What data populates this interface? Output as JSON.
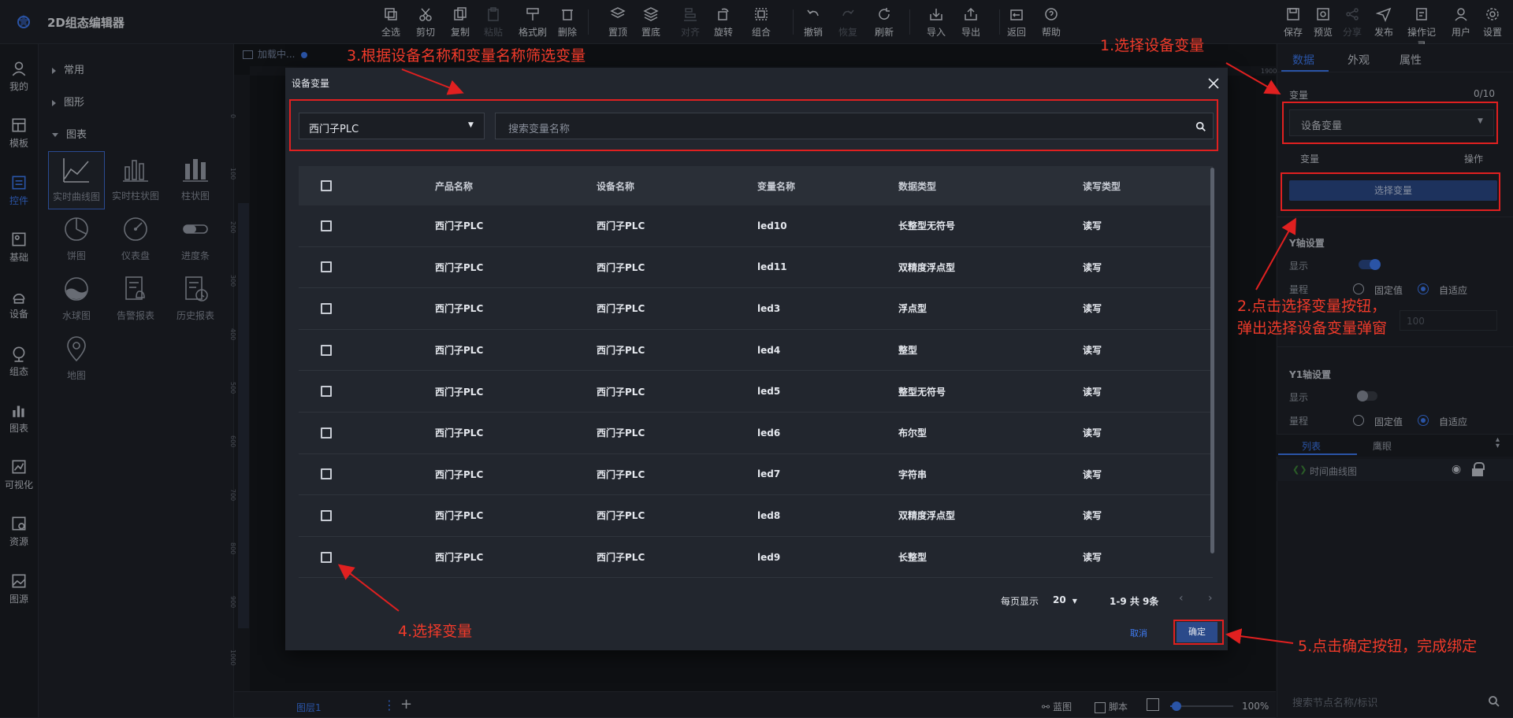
{
  "app": {
    "title": "2D组态编辑器"
  },
  "toolbar": {
    "items": [
      {
        "label": "全选",
        "icon": "select-all-icon",
        "disabled": false
      },
      {
        "label": "剪切",
        "icon": "cut-icon",
        "disabled": false
      },
      {
        "label": "复制",
        "icon": "copy-icon",
        "disabled": false
      },
      {
        "label": "粘贴",
        "icon": "paste-icon",
        "disabled": true
      },
      {
        "label": "格式刷",
        "icon": "format-brush-icon",
        "disabled": false
      },
      {
        "label": "删除",
        "icon": "delete-icon",
        "disabled": false
      },
      {
        "label": "置顶",
        "icon": "bring-to-front-icon",
        "disabled": false
      },
      {
        "label": "置底",
        "icon": "send-to-back-icon",
        "disabled": false
      },
      {
        "label": "对齐",
        "icon": "align-icon",
        "disabled": true
      },
      {
        "label": "旋转",
        "icon": "rotate-icon",
        "disabled": false
      },
      {
        "label": "组合",
        "icon": "group-icon",
        "disabled": false
      },
      {
        "label": "撤销",
        "icon": "undo-icon",
        "disabled": false
      },
      {
        "label": "恢复",
        "icon": "redo-icon",
        "disabled": true
      },
      {
        "label": "刷新",
        "icon": "refresh-icon",
        "disabled": false
      },
      {
        "label": "导入",
        "icon": "import-icon",
        "disabled": false
      },
      {
        "label": "导出",
        "icon": "export-icon",
        "disabled": false
      },
      {
        "label": "返回",
        "icon": "back-icon",
        "disabled": false
      },
      {
        "label": "帮助",
        "icon": "help-icon",
        "disabled": false
      }
    ],
    "right_items": [
      {
        "label": "保存",
        "icon": "save-icon",
        "disabled": false
      },
      {
        "label": "预览",
        "icon": "preview-icon",
        "disabled": false
      },
      {
        "label": "分享",
        "icon": "share-icon",
        "disabled": true
      },
      {
        "label": "发布",
        "icon": "publish-icon",
        "disabled": false
      },
      {
        "label": "操作记录",
        "icon": "history-icon",
        "disabled": false
      },
      {
        "label": "用户",
        "icon": "user-icon",
        "disabled": false
      },
      {
        "label": "设置",
        "icon": "settings-icon",
        "disabled": false
      }
    ]
  },
  "left_nav": {
    "items": [
      {
        "label": "我的",
        "icon": "user-icon",
        "active": false
      },
      {
        "label": "模板",
        "icon": "template-icon",
        "active": false
      },
      {
        "label": "控件",
        "icon": "widget-icon",
        "active": true
      },
      {
        "label": "基础",
        "icon": "basic-icon",
        "active": false
      },
      {
        "label": "设备",
        "icon": "device-icon",
        "active": false
      },
      {
        "label": "组态",
        "icon": "scada-icon",
        "active": false
      },
      {
        "label": "图表",
        "icon": "chart-icon",
        "active": false
      },
      {
        "label": "可视化",
        "icon": "visual-icon",
        "active": false
      },
      {
        "label": "资源",
        "icon": "resource-icon",
        "active": false
      },
      {
        "label": "图源",
        "icon": "image-source-icon",
        "active": false
      }
    ]
  },
  "component_panel": {
    "groups": [
      "常用",
      "图形",
      "图表"
    ],
    "components": [
      {
        "label": "实时曲线图",
        "icon": "line-chart-icon",
        "selected": true
      },
      {
        "label": "实时柱状图",
        "icon": "realtime-bar-chart-icon",
        "selected": false
      },
      {
        "label": "柱状图",
        "icon": "bar-chart-icon",
        "selected": false
      },
      {
        "label": "饼图",
        "icon": "pie-chart-icon",
        "selected": false
      },
      {
        "label": "仪表盘",
        "icon": "gauge-icon",
        "selected": false
      },
      {
        "label": "进度条",
        "icon": "progress-icon",
        "selected": false
      },
      {
        "label": "水球图",
        "icon": "liquid-fill-icon",
        "selected": false
      },
      {
        "label": "告警报表",
        "icon": "alarm-report-icon",
        "selected": false
      },
      {
        "label": "历史报表",
        "icon": "history-report-icon",
        "selected": false
      },
      {
        "label": "地图",
        "icon": "map-icon",
        "selected": false
      }
    ]
  },
  "canvas": {
    "tab_label": "加载中...",
    "ruler_top_end": "1900",
    "ruler_left": [
      "0",
      "100",
      "200",
      "300",
      "400",
      "500",
      "600",
      "700",
      "800",
      "900",
      "1000"
    ]
  },
  "bottom_bar": {
    "layer_label": "图层1",
    "blueprint_label": "蓝图",
    "script_label": "脚本",
    "zoom": "100%",
    "zoom_fraction": 0.1
  },
  "right_panel": {
    "tabs": [
      "数据",
      "外观",
      "属性"
    ],
    "active_tab": 0,
    "variable_label": "变量",
    "variable_count": "0/10",
    "variable_type_value": "设备变量",
    "col_variable": "变量",
    "col_action": "操作",
    "select_variable_button": "选择变量",
    "y_axis": {
      "title": "Y轴设置",
      "show_label": "显示",
      "range_label": "量程",
      "fixed_label": "固定值",
      "auto_label": "自适应",
      "max_placeholder": "100",
      "show_on": true
    },
    "y1_axis": {
      "title": "Y1轴设置",
      "show_label": "显示",
      "range_label": "量程",
      "fixed_label": "固定值",
      "auto_label": "自适应",
      "show_on": false
    },
    "list_tabs": [
      "列表",
      "鹰眼"
    ],
    "tree_node": "时间曲线图",
    "search_placeholder": "搜索节点名称/标识"
  },
  "modal": {
    "title": "设备变量",
    "device_select": "西门子PLC",
    "search_placeholder": "搜索变量名称",
    "columns": [
      "产品名称",
      "设备名称",
      "变量名称",
      "数据类型",
      "读写类型"
    ],
    "rows": [
      [
        "西门子PLC",
        "西门子PLC",
        "led10",
        "长整型无符号",
        "读写"
      ],
      [
        "西门子PLC",
        "西门子PLC",
        "led11",
        "双精度浮点型",
        "读写"
      ],
      [
        "西门子PLC",
        "西门子PLC",
        "led3",
        "浮点型",
        "读写"
      ],
      [
        "西门子PLC",
        "西门子PLC",
        "led4",
        "整型",
        "读写"
      ],
      [
        "西门子PLC",
        "西门子PLC",
        "led5",
        "整型无符号",
        "读写"
      ],
      [
        "西门子PLC",
        "西门子PLC",
        "led6",
        "布尔型",
        "读写"
      ],
      [
        "西门子PLC",
        "西门子PLC",
        "led7",
        "字符串",
        "读写"
      ],
      [
        "西门子PLC",
        "西门子PLC",
        "led8",
        "双精度浮点型",
        "读写"
      ],
      [
        "西门子PLC",
        "西门子PLC",
        "led9",
        "长整型",
        "读写"
      ]
    ],
    "page_size_label": "每页显示",
    "page_size": "20",
    "page_info": "1-9 共 9条",
    "cancel_label": "取消",
    "confirm_label": "确定"
  },
  "annotations": {
    "step1": "1.选择设备变量",
    "step2_line1": "2.点击选择变量按钮，",
    "step2_line2": "弹出选择设备变量弹窗",
    "step3": "3.根据设备名称和变量名称筛选变量",
    "step4": "4.选择变量",
    "step5": "5.点击确定按钮，完成绑定",
    "color": "#e02020"
  },
  "colors": {
    "accent": "#3f7cf5",
    "annotation": "#e02020",
    "bg": "#1b1e24"
  }
}
